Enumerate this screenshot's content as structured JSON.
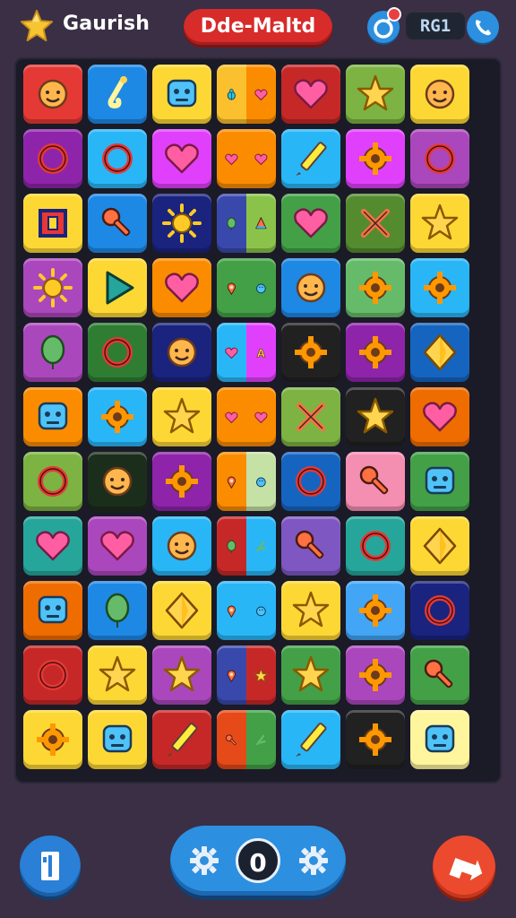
{
  "header": {
    "player_name": "Gaurish",
    "title": "Dde-Maltd",
    "counter": "RG1",
    "star_color": "#f7c531",
    "title_color": "#d72c2a"
  },
  "board": {
    "rows": 11,
    "cols": 7,
    "tiles": [
      [
        [
          "#e53935",
          "face"
        ],
        [
          "#1e88e5",
          "hook"
        ],
        [
          "#fdd835",
          "robot"
        ],
        [
          "#fbc02d|#fb8c00",
          "bug|heart"
        ],
        [
          "#c62828",
          "heart"
        ],
        [
          "#7cb342",
          "star"
        ],
        [
          "#fdd835",
          "face"
        ]
      ],
      [
        [
          "#8e24aa",
          "ring"
        ],
        [
          "#29b6f6",
          "ring"
        ],
        [
          "#e040fb",
          "heart"
        ],
        [
          "#fb8c00",
          "heart|heart"
        ],
        [
          "#29b6f6",
          "pencil"
        ],
        [
          "#e040fb",
          "gear"
        ],
        [
          "#ab47bc",
          "ring"
        ]
      ],
      [
        [
          "#fdd835",
          "square"
        ],
        [
          "#1e88e5",
          "key"
        ],
        [
          "#1a237e",
          "sun"
        ],
        [
          "#3949ab|#8bc34a",
          "balloon|cone"
        ],
        [
          "#43a047",
          "heart"
        ],
        [
          "#558b2f",
          "cross"
        ],
        [
          "#fdd835",
          "star"
        ]
      ],
      [
        [
          "#ab47bc",
          "sun"
        ],
        [
          "#fdd835",
          "play"
        ],
        [
          "#fb8c00",
          "heart"
        ],
        [
          "#43a047",
          "pin|ball"
        ],
        [
          "#1e88e5",
          "face"
        ],
        [
          "#66bb6a",
          "gear"
        ],
        [
          "#29b6f6",
          "gear"
        ]
      ],
      [
        [
          "#ab47bc",
          "balloon"
        ],
        [
          "#2e7d32",
          "ring"
        ],
        [
          "#1a237e",
          "face"
        ],
        [
          "#29b6f6|#e040fb",
          "heart|letter"
        ],
        [
          "#212121",
          "gear"
        ],
        [
          "#8e24aa",
          "gear"
        ],
        [
          "#1565c0",
          "diamond"
        ]
      ],
      [
        [
          "#fb8c00",
          "robot"
        ],
        [
          "#29b6f6",
          "gear"
        ],
        [
          "#fdd835",
          "star"
        ],
        [
          "#fb8c00",
          "heart|heart"
        ],
        [
          "#7cb342",
          "cross"
        ],
        [
          "#212121",
          "star"
        ],
        [
          "#ef6c00",
          "heart"
        ]
      ],
      [
        [
          "#7cb342",
          "ring"
        ],
        [
          "#1b2e1b",
          "face"
        ],
        [
          "#8e24aa",
          "gear"
        ],
        [
          "#fb8c00|#c5e1a5",
          "pin|ball"
        ],
        [
          "#1565c0",
          "ring"
        ],
        [
          "#f48fb1",
          "key"
        ],
        [
          "#43a047",
          "robot"
        ]
      ],
      [
        [
          "#26a69a",
          "heart"
        ],
        [
          "#ab47bc",
          "heart"
        ],
        [
          "#29b6f6",
          "face"
        ],
        [
          "#c62828|#29b6f6",
          "balloon|arrow"
        ],
        [
          "#7e57c2",
          "key"
        ],
        [
          "#26a69a",
          "ring"
        ],
        [
          "#fdd835",
          "diamond"
        ]
      ],
      [
        [
          "#ef6c00",
          "robot"
        ],
        [
          "#1e88e5",
          "balloon"
        ],
        [
          "#fdd835",
          "diamond"
        ],
        [
          "#29b6f6",
          "pin|ball"
        ],
        [
          "#fdd835",
          "star"
        ],
        [
          "#42a5f5",
          "gear"
        ],
        [
          "#1a237e",
          "ring"
        ]
      ],
      [
        [
          "#c62828",
          "ring"
        ],
        [
          "#fdd835",
          "star"
        ],
        [
          "#ab47bc",
          "star"
        ],
        [
          "#3949ab|#c62828",
          "pin|star"
        ],
        [
          "#43a047",
          "star"
        ],
        [
          "#ab47bc",
          "gear"
        ],
        [
          "#43a047",
          "key"
        ]
      ],
      [
        [
          "#fdd835",
          "gear"
        ],
        [
          "#fdd835",
          "robot"
        ],
        [
          "#c62828",
          "pencil"
        ],
        [
          "#e64a19|#43a047",
          "key|arrow"
        ],
        [
          "#29b6f6",
          "pencil"
        ],
        [
          "#212121",
          "gear"
        ],
        [
          "#fff59d",
          "robot"
        ]
      ]
    ]
  },
  "footer": {
    "center_label": "0"
  }
}
